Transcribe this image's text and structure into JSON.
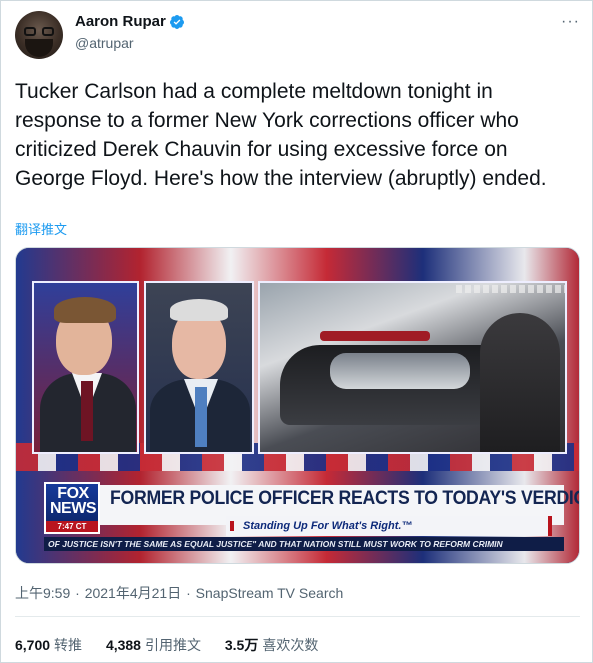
{
  "author": {
    "name": "Aaron Rupar",
    "handle": "@atrupar",
    "verified": true
  },
  "more_label": "···",
  "tweet": {
    "text": "Tucker Carlson had a complete meltdown tonight in response to a former New York corrections officer who criticized Derek Chauvin for using excessive force on George Floyd. Here's how the interview (abruptly) ended.",
    "translate_label": "翻译推文"
  },
  "media": {
    "network_logo": "FOX NEWS",
    "broadcast_time": "7:47 CT",
    "headline": "FORMER POLICE OFFICER REACTS TO TODAY'S VERDICT",
    "subheadline": "Standing Up For What's Right.™",
    "ticker": "OF JUSTICE ISN'T THE SAME AS EQUAL JUSTICE\" AND THAT NATION STILL MUST WORK TO REFORM CRIMIN"
  },
  "meta": {
    "time": "上午9:59",
    "date": "2021年4月21日",
    "source": "SnapStream TV Search",
    "separator": "·"
  },
  "stats": [
    {
      "value": "6,700",
      "label": "转推"
    },
    {
      "value": "4,388",
      "label": "引用推文"
    },
    {
      "value": "3.5万",
      "label": "喜欢次数"
    }
  ],
  "colors": {
    "link": "#1d9bf0",
    "secondary_text": "#536471",
    "verified": "#1d9bf0"
  }
}
